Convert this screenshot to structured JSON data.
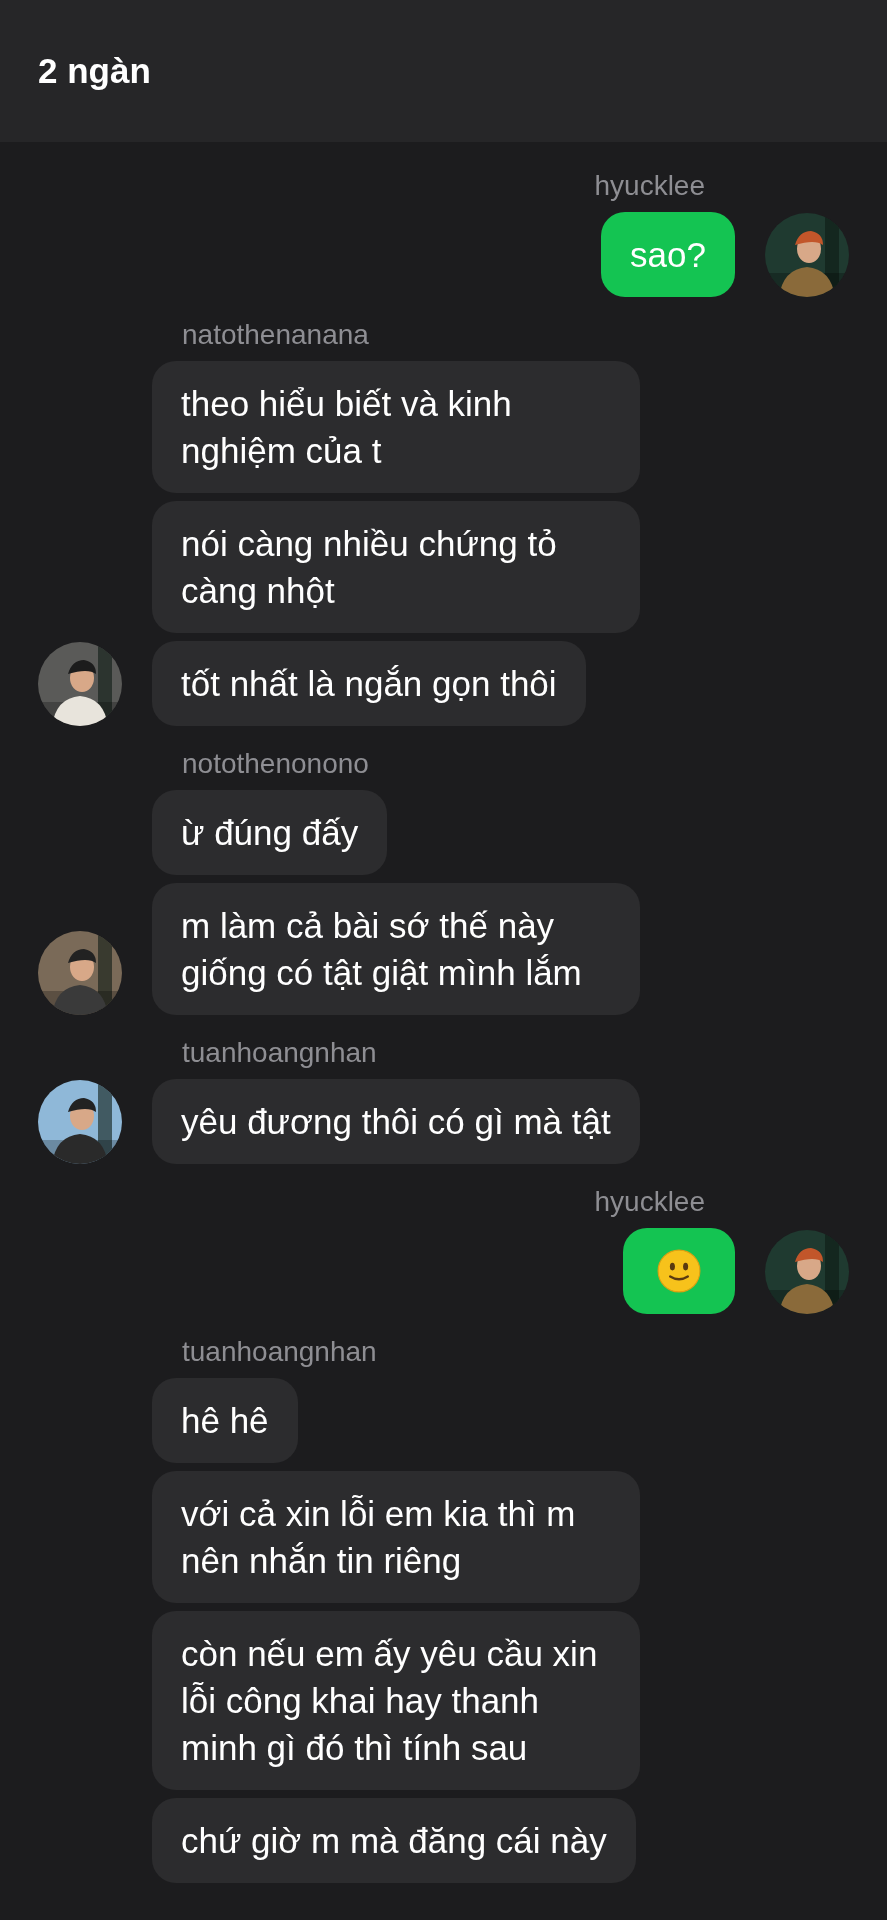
{
  "header": {
    "title": "2 ngàn"
  },
  "groups": [
    {
      "sender": "hyucklee",
      "kind": "outgoing",
      "avatar": {
        "kind": "picture"
      },
      "messages": [
        {
          "kind": "text",
          "text": "sao?"
        }
      ]
    },
    {
      "sender": "natothenanana",
      "kind": "incoming",
      "avatar": {
        "kind": "picture"
      },
      "messages": [
        {
          "kind": "text",
          "text": "theo hiểu biết và kinh nghiệm của t"
        },
        {
          "kind": "text",
          "text": "nói càng nhiều chứng tỏ càng nhột"
        },
        {
          "kind": "text",
          "text": "tốt nhất là ngắn gọn thôi"
        }
      ]
    },
    {
      "sender": "notothenonono",
      "kind": "incoming",
      "avatar": {
        "kind": "picture"
      },
      "messages": [
        {
          "kind": "text",
          "text": "ừ đúng đấy"
        },
        {
          "kind": "text",
          "text": "m làm cả bài sớ thế này giống có tật giật mình lắm"
        }
      ]
    },
    {
      "sender": "tuanhoangnhan",
      "kind": "incoming",
      "avatar": {
        "kind": "picture"
      },
      "messages": [
        {
          "kind": "text",
          "text": "yêu đương thôi có gì mà tật"
        }
      ]
    },
    {
      "sender": "hyucklee",
      "kind": "outgoing",
      "avatar": {
        "kind": "picture"
      },
      "messages": [
        {
          "kind": "emoji"
        }
      ]
    },
    {
      "sender": "tuanhoangnhan",
      "kind": "incoming",
      "messages": [
        {
          "kind": "text",
          "text": "hê hê"
        },
        {
          "kind": "text",
          "text": "với cả xin lỗi em kia thì m nên nhắn tin riêng"
        },
        {
          "kind": "text",
          "text": "còn nếu em ấy yêu cầu xin lỗi công khai hay thanh minh gì đó thì tính sau"
        },
        {
          "kind": "text",
          "text": "chứ giờ m mà đăng cái này"
        }
      ]
    }
  ]
}
